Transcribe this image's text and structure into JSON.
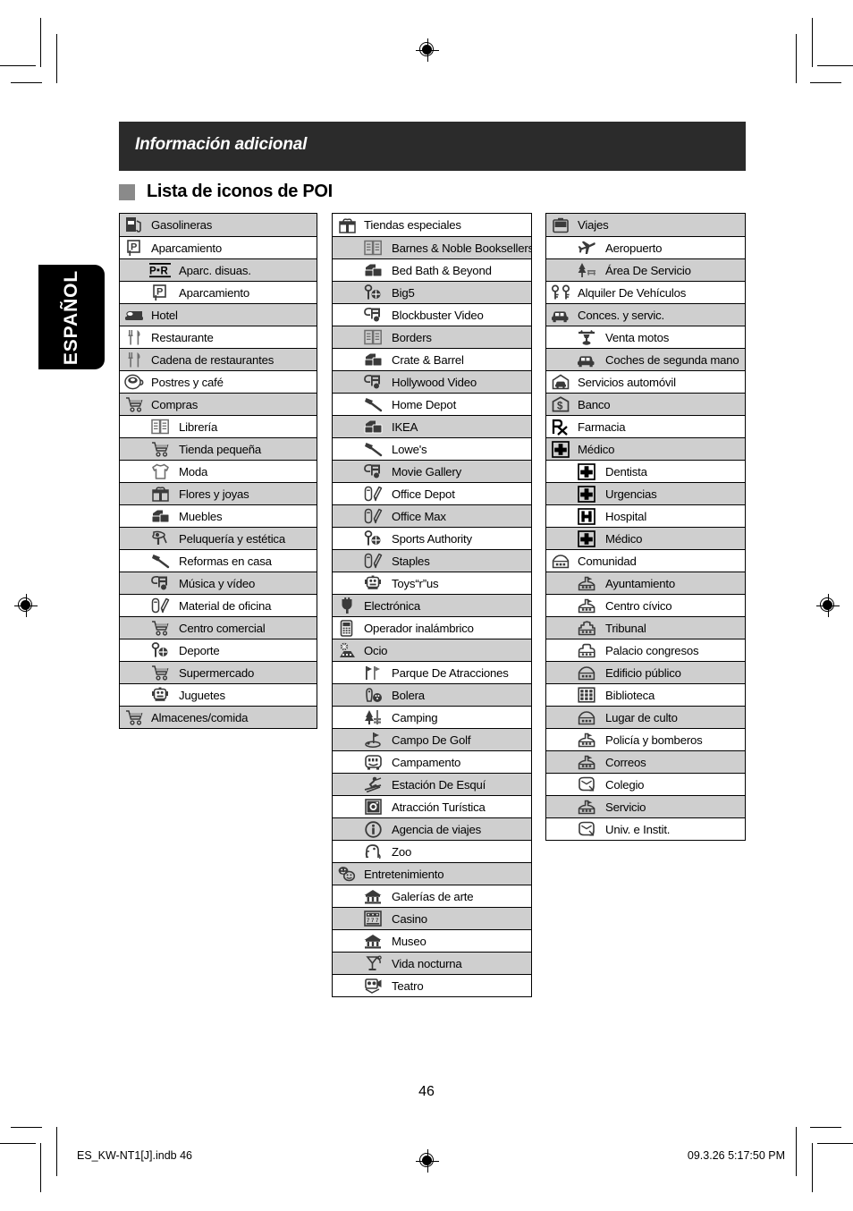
{
  "banner": {
    "title": "Información adicional"
  },
  "heading": {
    "text": "Lista de iconos de POI"
  },
  "lang_tab": {
    "label": "ESPAÑOL"
  },
  "page": {
    "number": "46"
  },
  "footer": {
    "left": "ES_KW-NT1[J].indb   46",
    "right": "09.3.26   5:17:50 PM"
  },
  "colors": {
    "banner_bg": "#2b2b2b",
    "row_shade": "#cfcfcf",
    "heading_square": "#8a8a8a",
    "tab_bg": "#000000"
  },
  "columns": [
    {
      "groups": [
        {
          "rows": [
            {
              "label": "Gasolineras",
              "icon": "gas-pump-icon",
              "sub": false,
              "shade": true
            }
          ]
        },
        {
          "rows": [
            {
              "label": "Aparcamiento",
              "icon": "parking-p-icon",
              "sub": false,
              "shade": false
            },
            {
              "label": "Aparc. disuas.",
              "icon": "park-and-ride-icon",
              "sub": true,
              "shade": true
            },
            {
              "label": "Aparcamiento",
              "icon": "parking-p-icon",
              "sub": true,
              "shade": false
            }
          ]
        },
        {
          "rows": [
            {
              "label": "Hotel",
              "icon": "hotel-bed-icon",
              "sub": false,
              "shade": true
            }
          ]
        },
        {
          "rows": [
            {
              "label": "Restaurante",
              "icon": "restaurant-fork-knife-icon",
              "sub": false,
              "shade": false
            }
          ]
        },
        {
          "rows": [
            {
              "label": "Cadena de restaurantes",
              "icon": "restaurant-fork-knife-icon",
              "sub": false,
              "shade": true
            }
          ]
        },
        {
          "rows": [
            {
              "label": "Postres y café",
              "icon": "coffee-cup-icon",
              "sub": false,
              "shade": false
            }
          ]
        },
        {
          "rows": [
            {
              "label": "Compras",
              "icon": "shopping-cart-icon",
              "sub": false,
              "shade": true
            },
            {
              "label": "Librería",
              "icon": "book-icon",
              "sub": true,
              "shade": false
            },
            {
              "label": "Tienda pequeña",
              "icon": "shopping-cart-icon",
              "sub": true,
              "shade": true
            },
            {
              "label": "Moda",
              "icon": "tshirt-icon",
              "sub": true,
              "shade": false
            },
            {
              "label": "Flores y joyas",
              "icon": "gift-box-icon",
              "sub": true,
              "shade": true
            },
            {
              "label": "Muebles",
              "icon": "furniture-icon",
              "sub": true,
              "shade": false
            },
            {
              "label": "Peluquería y estética",
              "icon": "hairdryer-icon",
              "sub": true,
              "shade": true
            },
            {
              "label": "Reformas en casa",
              "icon": "hammer-icon",
              "sub": true,
              "shade": false
            },
            {
              "label": "Música y vídeo",
              "icon": "music-note-icon",
              "sub": true,
              "shade": true
            },
            {
              "label": "Material de oficina",
              "icon": "office-supplies-icon",
              "sub": true,
              "shade": false
            },
            {
              "label": "Centro comercial",
              "icon": "shopping-cart-icon",
              "sub": true,
              "shade": true
            },
            {
              "label": "Deporte",
              "icon": "sports-icon",
              "sub": true,
              "shade": false
            },
            {
              "label": "Supermercado",
              "icon": "shopping-cart-icon",
              "sub": true,
              "shade": true
            },
            {
              "label": "Juguetes",
              "icon": "toy-robot-icon",
              "sub": true,
              "shade": false
            }
          ]
        },
        {
          "rows": [
            {
              "label": "Almacenes/comida",
              "icon": "shopping-cart-icon",
              "sub": false,
              "shade": true
            }
          ]
        }
      ]
    },
    {
      "groups": [
        {
          "rows": [
            {
              "label": "Tiendas especiales",
              "icon": "gift-box-icon",
              "sub": false,
              "shade": false
            },
            {
              "label": "Barnes & Noble Booksellers",
              "icon": "book-icon",
              "sub": true,
              "shade": true
            },
            {
              "label": "Bed Bath & Beyond",
              "icon": "furniture-icon",
              "sub": true,
              "shade": false
            },
            {
              "label": "Big5",
              "icon": "sports-icon",
              "sub": true,
              "shade": true
            },
            {
              "label": "Blockbuster Video",
              "icon": "music-note-icon",
              "sub": true,
              "shade": false
            },
            {
              "label": "Borders",
              "icon": "book-icon",
              "sub": true,
              "shade": true
            },
            {
              "label": "Crate & Barrel",
              "icon": "furniture-icon",
              "sub": true,
              "shade": false
            },
            {
              "label": "Hollywood Video",
              "icon": "music-note-icon",
              "sub": true,
              "shade": true
            },
            {
              "label": "Home Depot",
              "icon": "hammer-icon",
              "sub": true,
              "shade": false
            },
            {
              "label": "IKEA",
              "icon": "furniture-icon",
              "sub": true,
              "shade": true
            },
            {
              "label": "Lowe's",
              "icon": "hammer-icon",
              "sub": true,
              "shade": false
            },
            {
              "label": "Movie Gallery",
              "icon": "music-note-icon",
              "sub": true,
              "shade": true
            },
            {
              "label": "Office Depot",
              "icon": "office-supplies-icon",
              "sub": true,
              "shade": false
            },
            {
              "label": "Office Max",
              "icon": "office-supplies-icon",
              "sub": true,
              "shade": true
            },
            {
              "label": "Sports Authority",
              "icon": "sports-icon",
              "sub": true,
              "shade": false
            },
            {
              "label": "Staples",
              "icon": "office-supplies-icon",
              "sub": true,
              "shade": true
            },
            {
              "label": "Toys“r”us",
              "icon": "toy-robot-icon",
              "sub": true,
              "shade": false
            }
          ]
        },
        {
          "rows": [
            {
              "label": "Electrónica",
              "icon": "plug-icon",
              "sub": false,
              "shade": true
            }
          ]
        },
        {
          "rows": [
            {
              "label": "Operador inalámbrico",
              "icon": "mobile-phone-icon",
              "sub": false,
              "shade": false
            }
          ]
        },
        {
          "rows": [
            {
              "label": "Ocio",
              "icon": "amusement-icon",
              "sub": false,
              "shade": true
            },
            {
              "label": "Parque De Atracciones",
              "icon": "flags-icon",
              "sub": true,
              "shade": false
            },
            {
              "label": "Bolera",
              "icon": "bowling-icon",
              "sub": true,
              "shade": true
            },
            {
              "label": "Camping",
              "icon": "camping-trees-icon",
              "sub": true,
              "shade": false
            },
            {
              "label": "Campo De Golf",
              "icon": "golf-flag-icon",
              "sub": true,
              "shade": true
            },
            {
              "label": "Campamento",
              "icon": "campground-icon",
              "sub": true,
              "shade": false
            },
            {
              "label": "Estación De Esquí",
              "icon": "skier-icon",
              "sub": true,
              "shade": true
            },
            {
              "label": "Atracción Turística",
              "icon": "camera-icon",
              "sub": true,
              "shade": false
            },
            {
              "label": "Agencia de viajes",
              "icon": "info-circle-icon",
              "sub": true,
              "shade": true
            },
            {
              "label": "Zoo",
              "icon": "zoo-elephant-icon",
              "sub": true,
              "shade": false
            }
          ]
        },
        {
          "rows": [
            {
              "label": "Entretenimiento",
              "icon": "masks-icon",
              "sub": false,
              "shade": true
            },
            {
              "label": "Galerías de arte",
              "icon": "museum-building-icon",
              "sub": true,
              "shade": false
            },
            {
              "label": "Casino",
              "icon": "casino-icon",
              "sub": true,
              "shade": true
            },
            {
              "label": "Museo",
              "icon": "museum-building-icon",
              "sub": true,
              "shade": false
            },
            {
              "label": "Vida nocturna",
              "icon": "nightlife-icon",
              "sub": true,
              "shade": true
            },
            {
              "label": "Teatro",
              "icon": "theater-icon",
              "sub": true,
              "shade": false
            }
          ]
        }
      ]
    },
    {
      "groups": [
        {
          "rows": [
            {
              "label": "Viajes",
              "icon": "briefcase-icon",
              "sub": false,
              "shade": true
            },
            {
              "label": "Aeropuerto",
              "icon": "airplane-icon",
              "sub": true,
              "shade": false
            },
            {
              "label": "Área De Servicio",
              "icon": "rest-area-icon",
              "sub": true,
              "shade": true
            }
          ]
        },
        {
          "rows": [
            {
              "label": "Alquiler De Vehículos",
              "icon": "car-key-icon",
              "sub": false,
              "shade": false
            }
          ]
        },
        {
          "rows": [
            {
              "label": "Conces. y servic.",
              "icon": "car-icon",
              "sub": false,
              "shade": true
            },
            {
              "label": "Venta motos",
              "icon": "motorcycle-icon",
              "sub": true,
              "shade": false
            },
            {
              "label": "Coches de segunda mano",
              "icon": "car-icon",
              "sub": true,
              "shade": true
            }
          ]
        },
        {
          "rows": [
            {
              "label": "Servicios automóvil",
              "icon": "car-garage-icon",
              "sub": false,
              "shade": false
            }
          ]
        },
        {
          "rows": [
            {
              "label": "Banco",
              "icon": "bank-dollar-icon",
              "sub": false,
              "shade": true
            }
          ]
        },
        {
          "rows": [
            {
              "label": "Farmacia",
              "icon": "pharmacy-rx-icon",
              "sub": false,
              "shade": false
            }
          ]
        },
        {
          "rows": [
            {
              "label": "Médico",
              "icon": "medical-cross-icon",
              "sub": false,
              "shade": true
            },
            {
              "label": "Dentista",
              "icon": "medical-cross-icon",
              "sub": true,
              "shade": false
            },
            {
              "label": "Urgencias",
              "icon": "medical-cross-icon",
              "sub": true,
              "shade": true
            },
            {
              "label": "Hospital",
              "icon": "hospital-h-icon",
              "sub": true,
              "shade": false
            },
            {
              "label": "Médico",
              "icon": "medical-cross-icon",
              "sub": true,
              "shade": true
            }
          ]
        },
        {
          "rows": [
            {
              "label": "Comunidad",
              "icon": "community-building-icon",
              "sub": false,
              "shade": false
            },
            {
              "label": "Ayuntamiento",
              "icon": "cityhall-icon",
              "sub": true,
              "shade": true
            },
            {
              "label": "Centro cívico",
              "icon": "cityhall-icon",
              "sub": true,
              "shade": false
            },
            {
              "label": "Tribunal",
              "icon": "courthouse-icon",
              "sub": true,
              "shade": true
            },
            {
              "label": "Palacio congresos",
              "icon": "convention-icon",
              "sub": true,
              "shade": false
            },
            {
              "label": "Edificio público",
              "icon": "community-building-icon",
              "sub": true,
              "shade": true
            },
            {
              "label": "Biblioteca",
              "icon": "library-icon",
              "sub": true,
              "shade": false
            },
            {
              "label": "Lugar de culto",
              "icon": "community-building-icon",
              "sub": true,
              "shade": true
            },
            {
              "label": "Policía y bomberos",
              "icon": "cityhall-icon",
              "sub": true,
              "shade": false
            },
            {
              "label": "Correos",
              "icon": "cityhall-icon",
              "sub": true,
              "shade": true
            },
            {
              "label": "Colegio",
              "icon": "school-icon",
              "sub": true,
              "shade": false
            },
            {
              "label": "Servicio",
              "icon": "cityhall-icon",
              "sub": true,
              "shade": true
            },
            {
              "label": "Univ. e Instit.",
              "icon": "school-icon",
              "sub": true,
              "shade": false
            }
          ]
        }
      ]
    }
  ]
}
